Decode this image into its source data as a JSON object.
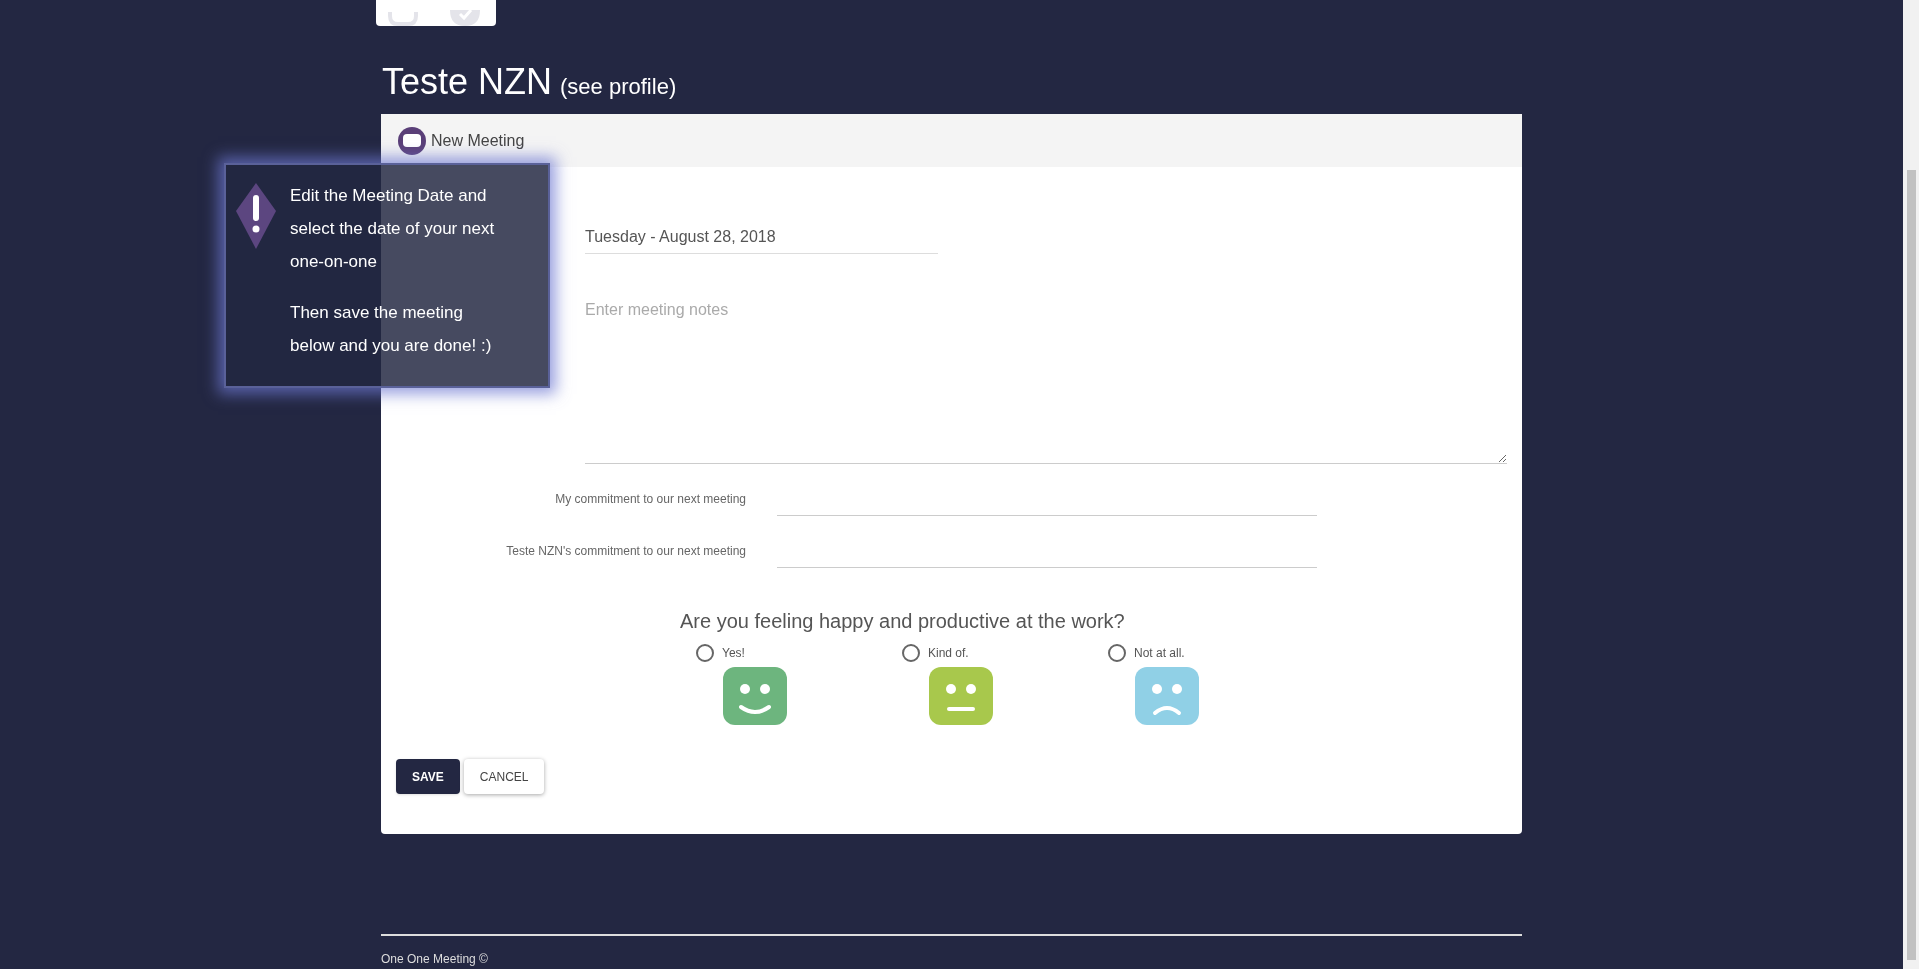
{
  "profile": {
    "name": "Teste NZN",
    "link": "(see profile)"
  },
  "panel": {
    "title": "New Meeting"
  },
  "date_field": {
    "value": "Tuesday - August 28, 2018"
  },
  "notes_field": {
    "placeholder": "Enter meeting notes"
  },
  "commitments": [
    {
      "label": "My commitment to our next meeting"
    },
    {
      "label": "Teste NZN's commitment to our next meeting"
    }
  ],
  "mood": {
    "question": "Are you feeling happy and productive at the work?",
    "options": [
      {
        "label": "Yes!",
        "kind": "happy",
        "color": "#6db57e",
        "selected": false
      },
      {
        "label": "Kind of.",
        "kind": "neutral",
        "color": "#a8c84c",
        "selected": false
      },
      {
        "label": "Not at all.",
        "kind": "sad",
        "color": "#90d0e6",
        "selected": false
      }
    ]
  },
  "buttons": [
    {
      "label": "SAVE",
      "kind": "primary"
    },
    {
      "label": "CANCEL",
      "kind": "secondary"
    }
  ],
  "tooltip": {
    "paragraphs": [
      "Edit the Meeting Date and select the date of your next one-on-one",
      "Then save the meeting below and you are done! :)"
    ]
  },
  "footer": {
    "text": "One One Meeting ©"
  }
}
